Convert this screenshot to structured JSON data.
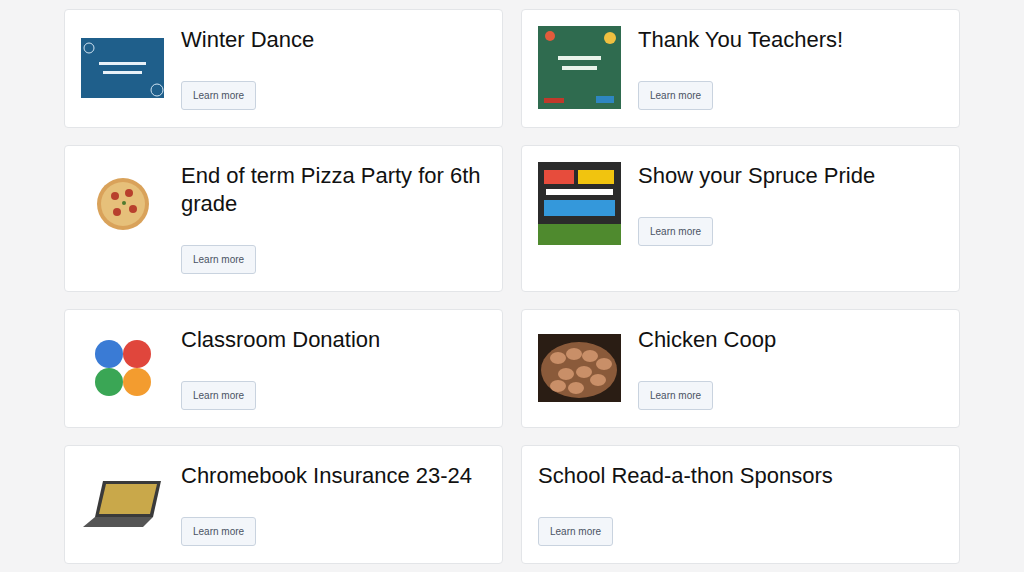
{
  "cards": [
    {
      "title": "Winter Dance",
      "button": "Learn more",
      "kind": "winter",
      "color": "#1f5f8b"
    },
    {
      "title": "Thank You Teachers!",
      "button": "Learn more",
      "kind": "chalkboard",
      "color": "#2f6b4f"
    },
    {
      "title": "End of term Pizza Party for 6th grade",
      "button": "Learn more",
      "kind": "pizza",
      "color": "#d9a25a"
    },
    {
      "title": "Show your Spruce Pride",
      "button": "Learn more",
      "kind": "pride",
      "color": "#2b2b2b"
    },
    {
      "title": "Classroom Donation",
      "button": "Learn more",
      "kind": "hands",
      "color": "#e0463c"
    },
    {
      "title": "Chicken Coop",
      "button": "Learn more",
      "kind": "eggs",
      "color": "#8a5a3a"
    },
    {
      "title": "Chromebook Insurance 23-24",
      "button": "Learn more",
      "kind": "laptop",
      "color": "#3a3a3a"
    },
    {
      "title": "School Read-a-thon Sponsors",
      "button": "Learn more",
      "kind": "none",
      "color": "#ffffff"
    }
  ]
}
